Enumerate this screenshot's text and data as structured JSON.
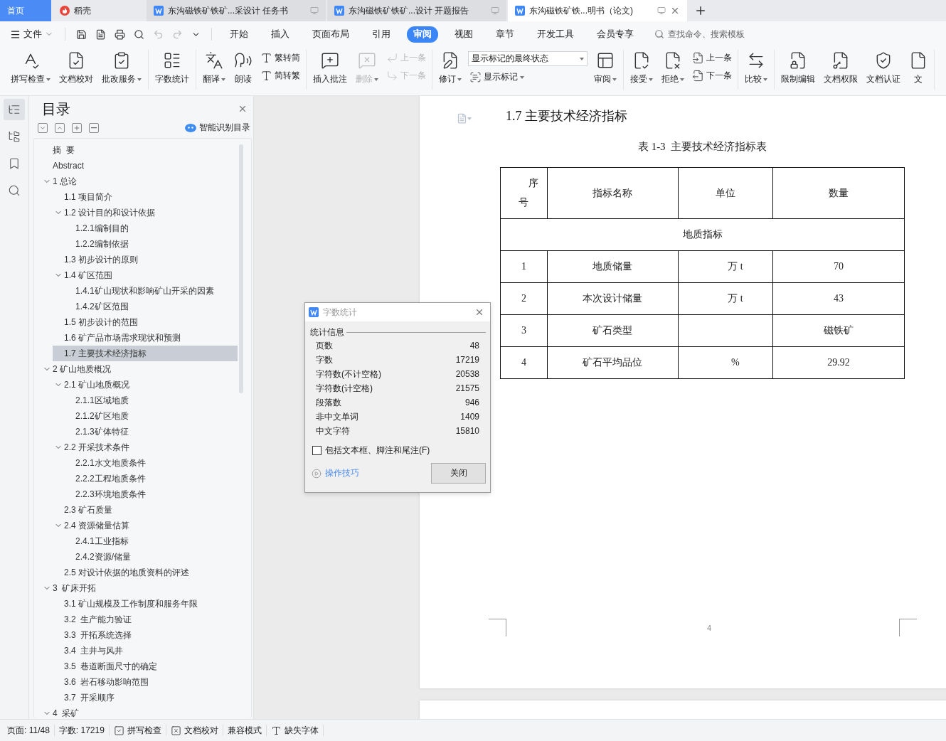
{
  "tabs": [
    {
      "kind": "home",
      "label": "首页",
      "selected": false
    },
    {
      "kind": "app",
      "label": "稻壳",
      "selected": false
    },
    {
      "kind": "doc",
      "label": "东沟磁铁矿铁矿...采设计 任务书",
      "selected": false
    },
    {
      "kind": "doc",
      "label": "东沟磁铁矿铁矿...设计 开题报告",
      "selected": false
    },
    {
      "kind": "doc",
      "label": "东沟磁铁矿铁...明书（论文)",
      "selected": true
    }
  ],
  "menu": {
    "file": "文件",
    "items": [
      {
        "label": "开始",
        "selected": false
      },
      {
        "label": "插入",
        "selected": false
      },
      {
        "label": "页面布局",
        "selected": false
      },
      {
        "label": "引用",
        "selected": false
      },
      {
        "label": "审阅",
        "selected": true
      },
      {
        "label": "视图",
        "selected": false
      },
      {
        "label": "章节",
        "selected": false
      },
      {
        "label": "开发工具",
        "selected": false
      },
      {
        "label": "会员专享",
        "selected": false
      }
    ],
    "search": {
      "placeholder": "查找命令、搜索模板"
    }
  },
  "ribbon": [
    {
      "items": [
        {
          "kind": "large",
          "label": "拼写检查",
          "dropdown": true,
          "disabled": false
        },
        {
          "kind": "large",
          "label": "文档校对",
          "dropdown": false,
          "disabled": false
        },
        {
          "kind": "large",
          "label": "批改服务",
          "dropdown": true,
          "disabled": false
        }
      ]
    },
    {
      "items": [
        {
          "kind": "large",
          "label": "字数统计",
          "dropdown": false,
          "disabled": false
        }
      ]
    },
    {
      "items": [
        {
          "kind": "large",
          "label": "翻译",
          "dropdown": true,
          "disabled": false
        },
        {
          "kind": "large",
          "label": "朗读",
          "dropdown": false,
          "disabled": false
        },
        {
          "kind": "stack",
          "rows": [
            {
              "kind": "small",
              "label": "繁转简",
              "dropdown": false,
              "disabled": false
            },
            {
              "kind": "small",
              "label": "简转繁",
              "dropdown": false,
              "disabled": false
            }
          ]
        }
      ]
    },
    {
      "items": [
        {
          "kind": "large",
          "label": "插入批注",
          "dropdown": false,
          "disabled": false
        },
        {
          "kind": "large",
          "label": "删除",
          "dropdown": true,
          "disabled": true
        },
        {
          "kind": "stack",
          "rows": [
            {
              "kind": "small",
              "label": "上一条",
              "dropdown": false,
              "disabled": true
            },
            {
              "kind": "small",
              "label": "下一条",
              "dropdown": false,
              "disabled": true
            }
          ]
        }
      ]
    },
    {
      "items": [
        {
          "kind": "large",
          "label": "修订",
          "dropdown": true,
          "disabled": false
        },
        {
          "kind": "stack",
          "rows": [
            {
              "kind": "select",
              "value": "显示标记的最终状态"
            },
            {
              "kind": "small",
              "label": "显示标记",
              "dropdown": true,
              "disabled": false
            }
          ]
        },
        {
          "kind": "large",
          "label": "审阅",
          "dropdown": true,
          "disabled": false
        }
      ]
    },
    {
      "items": [
        {
          "kind": "large",
          "label": "接受",
          "dropdown": true,
          "disabled": false
        },
        {
          "kind": "large",
          "label": "拒绝",
          "dropdown": true,
          "disabled": false
        },
        {
          "kind": "stack",
          "rows": [
            {
              "kind": "small",
              "label": "上一条",
              "dropdown": false,
              "disabled": false
            },
            {
              "kind": "small",
              "label": "下一条",
              "dropdown": false,
              "disabled": false
            }
          ]
        }
      ]
    },
    {
      "items": [
        {
          "kind": "large",
          "label": "比较",
          "dropdown": true,
          "disabled": false
        }
      ]
    },
    {
      "items": [
        {
          "kind": "large",
          "label": "限制编辑",
          "dropdown": false,
          "disabled": false
        },
        {
          "kind": "large",
          "label": "文档权限",
          "dropdown": false,
          "disabled": false
        },
        {
          "kind": "large",
          "label": "文档认证",
          "dropdown": false,
          "disabled": false
        },
        {
          "kind": "large",
          "label": "文",
          "dropdown": false,
          "disabled": false
        }
      ]
    }
  ],
  "rail": [
    {
      "selected": true
    },
    {
      "selected": false
    },
    {
      "selected": false
    },
    {
      "selected": false
    }
  ],
  "nav": {
    "title": "目录",
    "smart": "智能识别目录",
    "tree": [
      {
        "label": "摘  要",
        "selected": false
      },
      {
        "label": "Abstract",
        "selected": false
      },
      {
        "label": "1 总论",
        "selected": false,
        "expanded": true,
        "children": [
          {
            "label": "1.1 项目简介",
            "selected": false
          },
          {
            "label": "1.2 设计目的和设计依据",
            "selected": false,
            "expanded": true,
            "children": [
              {
                "label": "1.2.1编制目的",
                "selected": false
              },
              {
                "label": "1.2.2编制依据",
                "selected": false
              }
            ]
          },
          {
            "label": "1.3 初步设计的原则",
            "selected": false
          },
          {
            "label": "1.4 矿区范围",
            "selected": false,
            "expanded": true,
            "children": [
              {
                "label": "1.4.1矿山现状和影响矿山开采的因素",
                "selected": false
              },
              {
                "label": "1.4.2矿区范围",
                "selected": false
              }
            ]
          },
          {
            "label": "1.5 初步设计的范围",
            "selected": false
          },
          {
            "label": "1.6 矿产品市场需求现状和预测",
            "selected": false
          },
          {
            "label": "1.7 主要技术经济指标",
            "selected": true
          }
        ]
      },
      {
        "label": "2 矿山地质概况",
        "selected": false,
        "expanded": true,
        "children": [
          {
            "label": "2.1 矿山地质概况",
            "selected": false,
            "expanded": true,
            "children": [
              {
                "label": "2.1.1区域地质",
                "selected": false
              },
              {
                "label": "2.1.2矿区地质",
                "selected": false
              },
              {
                "label": "2.1.3矿体特征",
                "selected": false
              }
            ]
          },
          {
            "label": "2.2 开采技术条件",
            "selected": false,
            "expanded": true,
            "children": [
              {
                "label": "2.2.1水文地质条件",
                "selected": false
              },
              {
                "label": "2.2.2工程地质条件",
                "selected": false
              },
              {
                "label": "2.2.3环境地质条件",
                "selected": false
              }
            ]
          },
          {
            "label": "2.3 矿石质量",
            "selected": false
          },
          {
            "label": "2.4 资源储量估算",
            "selected": false,
            "expanded": true,
            "children": [
              {
                "label": "2.4.1工业指标",
                "selected": false
              },
              {
                "label": "2.4.2资源/储量",
                "selected": false
              }
            ]
          },
          {
            "label": "2.5 对设计依据的地质资料的评述",
            "selected": false
          }
        ]
      },
      {
        "label": "3  矿床开拓",
        "selected": false,
        "expanded": true,
        "children": [
          {
            "label": "3.1 矿山规模及工作制度和服务年限",
            "selected": false
          },
          {
            "label": "3.2  生产能力验证",
            "selected": false
          },
          {
            "label": "3.3  开拓系统选择",
            "selected": false
          },
          {
            "label": "3.4  主井与风井",
            "selected": false
          },
          {
            "label": "3.5  巷道断面尺寸的确定",
            "selected": false
          },
          {
            "label": "3.6  岩石移动影响范围",
            "selected": false
          },
          {
            "label": "3.7  开采顺序",
            "selected": false
          }
        ]
      },
      {
        "label": "4  采矿",
        "selected": false,
        "expanded": true
      }
    ]
  },
  "document": {
    "heading": "1.7 主要技术经济指标",
    "caption": "表 1-3  主要技术经济指标表",
    "columns": [
      "序号",
      "指标名称",
      "单位",
      "数量"
    ],
    "section": "地质指标",
    "rows": [
      [
        "1",
        "地质储量",
        "万 t",
        "70"
      ],
      [
        "2",
        "本次设计储量",
        "万 t",
        "43"
      ],
      [
        "3",
        "矿石类型",
        "",
        "磁铁矿"
      ],
      [
        "4",
        "矿石平均品位",
        "%",
        "29.92"
      ]
    ],
    "page_number": "4"
  },
  "dialog": {
    "title": "字数统计",
    "section": "统计信息",
    "stats": [
      {
        "label": "页数",
        "value": "48"
      },
      {
        "label": "字数",
        "value": "17219"
      },
      {
        "label": "字符数(不计空格)",
        "value": "20538"
      },
      {
        "label": "字符数(计空格)",
        "value": "21575"
      },
      {
        "label": "段落数",
        "value": "946"
      },
      {
        "label": "非中文单词",
        "value": "1409"
      },
      {
        "label": "中文字符",
        "value": "15810"
      }
    ],
    "checkbox": {
      "label": "包括文本框、脚注和尾注(F)",
      "checked": false
    },
    "link": "操作技巧",
    "button": "关闭"
  },
  "status_bar": [
    {
      "kind": "text",
      "label": "页面: 11/48"
    },
    {
      "kind": "text",
      "label": "字数: 17219"
    },
    {
      "kind": "check",
      "label": "拼写检查"
    },
    {
      "kind": "proof",
      "label": "文档校对"
    },
    {
      "kind": "text",
      "label": "兼容模式"
    },
    {
      "kind": "font",
      "label": "缺失字体"
    }
  ]
}
